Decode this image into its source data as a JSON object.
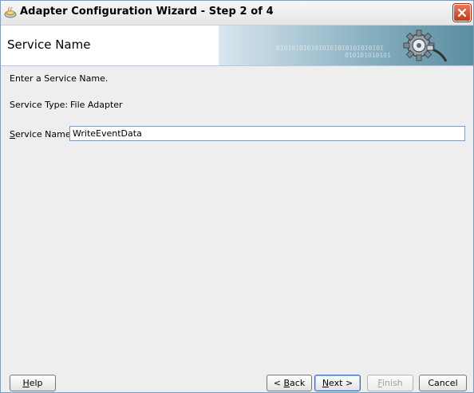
{
  "window": {
    "title": "Adapter Configuration Wizard - Step 2 of 4",
    "icons": {
      "app": "coffee-cup-icon",
      "close": "close-icon"
    }
  },
  "header": {
    "title": "Service Name",
    "banner_text_1": "0101010101010101010101010101",
    "banner_text_2": "010101010101",
    "banner_icon": "gear-plug-icon"
  },
  "form": {
    "instructions": "Enter a Service Name.",
    "service_type_label": "Service Type:",
    "service_type_value": "File Adapter",
    "service_name_label_prefix": "S",
    "service_name_label_rest": "ervice Name:",
    "service_name_value": "WriteEventData"
  },
  "buttons": {
    "help_mnemonic": "H",
    "help_rest": "elp",
    "back_prefix": "< ",
    "back_mnemonic": "B",
    "back_rest": "ack",
    "next_mnemonic": "N",
    "next_rest": "ext >",
    "finish_mnemonic": "F",
    "finish_rest": "inish",
    "finish_enabled": false,
    "cancel": "Cancel"
  },
  "colors": {
    "title_bar": "#e6e6e6",
    "close_button": "#c13b1c",
    "banner_accent": "#5c8ea1",
    "input_border": "#7f9db9",
    "default_button_border": "#3c6ab0"
  }
}
